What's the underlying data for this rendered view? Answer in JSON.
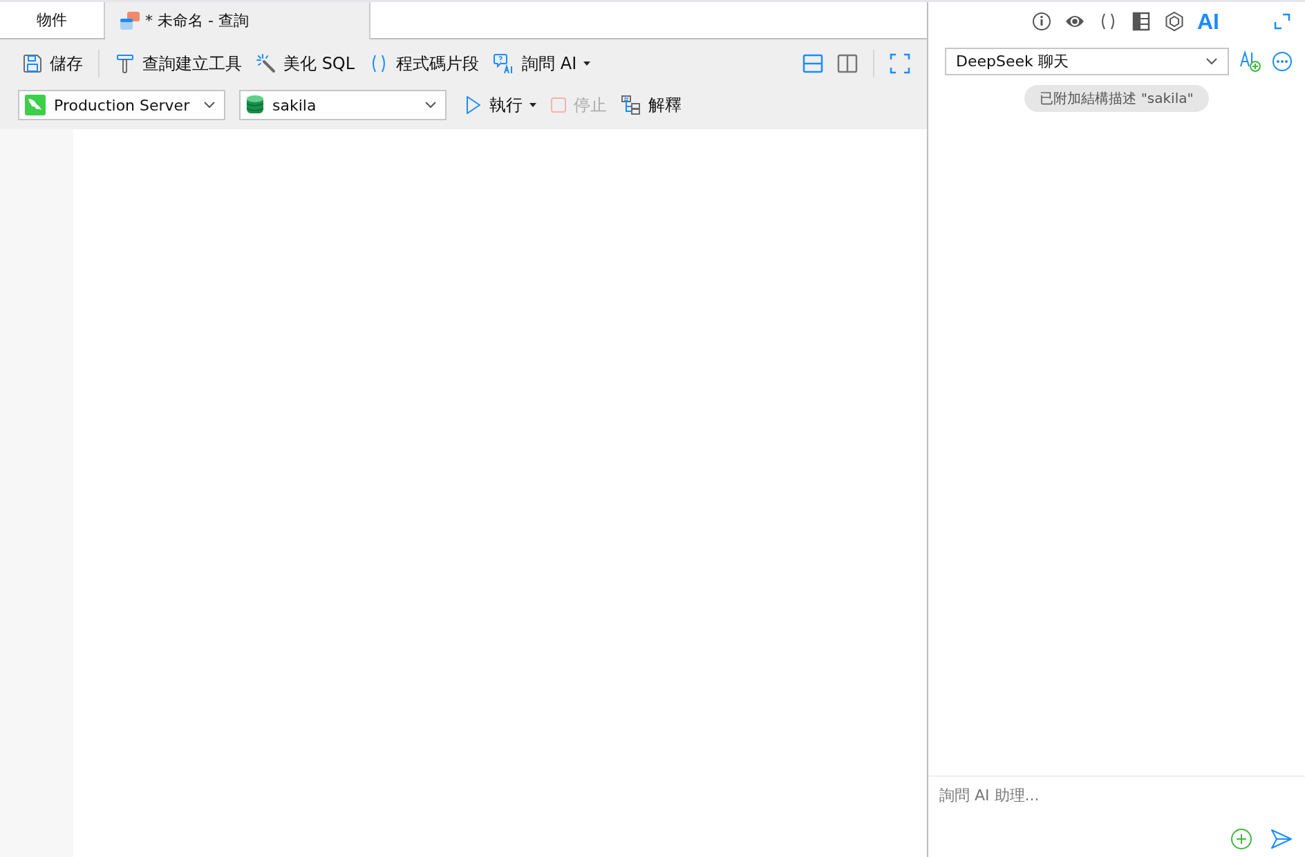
{
  "tabs": [
    {
      "label": "物件",
      "selected": false
    },
    {
      "label": "* 未命名 - 查詢",
      "selected": true
    }
  ],
  "toolbar": {
    "actions": [
      {
        "kind": "save",
        "label": "儲存"
      },
      {
        "kind": "builder",
        "label": "查詢建立工具"
      },
      {
        "kind": "beautify",
        "label": "美化 SQL"
      },
      {
        "kind": "snippet",
        "label": "程式碼片段"
      },
      {
        "kind": "ask",
        "label": "詢問 AI",
        "dropdown": true
      }
    ],
    "layouts": [
      {
        "kind": "horizontal",
        "selected": true
      },
      {
        "kind": "vertical",
        "selected": false
      }
    ],
    "connection": "Production Server",
    "database": "sakila",
    "run_actions": [
      {
        "kind": "run",
        "label": "執行",
        "dropdown": true,
        "disabled": false
      },
      {
        "kind": "stop",
        "label": "停止",
        "dropdown": false,
        "disabled": true
      },
      {
        "kind": "explain",
        "label": "解釋",
        "dropdown": false,
        "disabled": false
      }
    ]
  },
  "side_panel": {
    "tabs": [
      {
        "kind": "info",
        "selected": false
      },
      {
        "kind": "eye",
        "selected": false
      },
      {
        "kind": "parens",
        "selected": false
      },
      {
        "kind": "grid",
        "selected": false
      },
      {
        "kind": "hexagon",
        "selected": false
      },
      {
        "kind": "ai",
        "label": "AI",
        "selected": true
      }
    ],
    "model": "DeepSeek 聊天",
    "chip": "已附加結構描述 \"sakila\"",
    "input": {
      "placeholder": "詢問 AI 助理..."
    }
  }
}
